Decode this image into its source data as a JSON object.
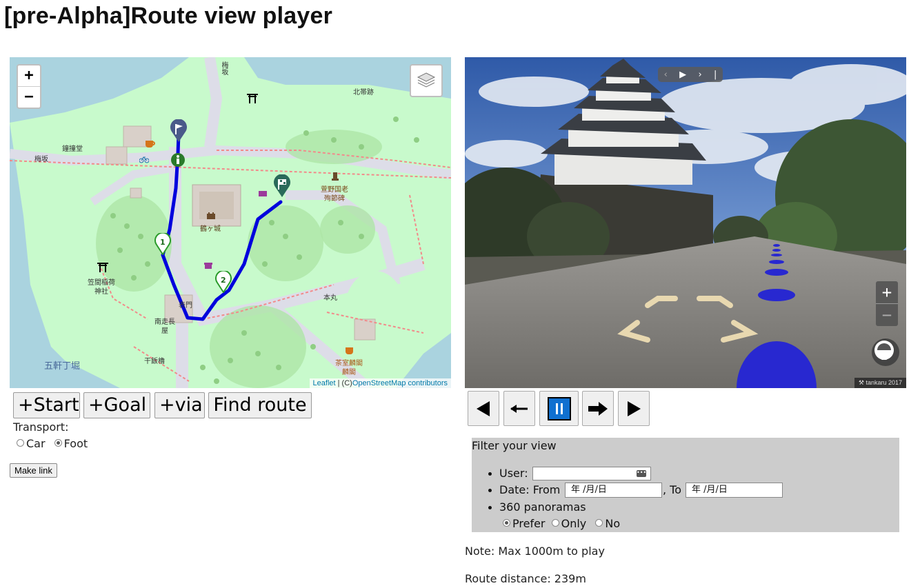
{
  "page": {
    "title": "[pre-Alpha]Route view player"
  },
  "map": {
    "zoom_in": "+",
    "zoom_out": "−",
    "attribution_leaflet": "Leaflet",
    "attribution_sep": " | (C)",
    "attribution_osm": "OpenStreetMap contributors",
    "labels": {
      "ume_saka": "梅坂",
      "ume_saka_top": "梅坂",
      "kitadeguruwa": "北帯跡",
      "hoshodo": "鐘撞堂",
      "kayano": "萱野国老",
      "kayano2": "殉節碑",
      "tsurugajo": "鶴ヶ城",
      "honmaru": "本丸",
      "kasama": "笠間稲荷",
      "kasama2": "神社",
      "minami": "南走長",
      "minami2": "屋",
      "gokencho": "五軒丁堀",
      "senbanyagura": "干飯櫓",
      "chashitsu": "茶室麟閣",
      "chashitsu2": "麟閣",
      "omotemon": "表門",
      "waypoint1": "1",
      "waypoint2": "2"
    },
    "route_color": "#0000dd"
  },
  "pano": {
    "nav_prev": "‹",
    "nav_play": "▶",
    "nav_next": "›",
    "nav_end": "|",
    "zoom_in": "+",
    "zoom_out": "−",
    "credit": "tankaru 2017"
  },
  "route_controls": {
    "start": "+Start",
    "goal": "+Goal",
    "via": "+via",
    "find": "Find route"
  },
  "transport": {
    "label": "Transport:",
    "options": [
      "Car",
      "Foot"
    ],
    "selected": "Foot"
  },
  "make_link": "Make link",
  "player": {
    "buttons": [
      "first",
      "back",
      "pause",
      "forward",
      "last"
    ]
  },
  "filter": {
    "title": "Filter your view",
    "user_label": "User:",
    "user_value": "",
    "date_label": "Date: From",
    "date_from_placeholder": "年 /月/日",
    "date_to_label": ", To",
    "date_to_placeholder": "年 /月/日",
    "pano_label": "360 panoramas",
    "pano_options": [
      "Prefer",
      "Only",
      "No"
    ],
    "pano_selected": "Prefer"
  },
  "note": "Note: Max 1000m to play",
  "route_distance": "Route distance: 239m"
}
